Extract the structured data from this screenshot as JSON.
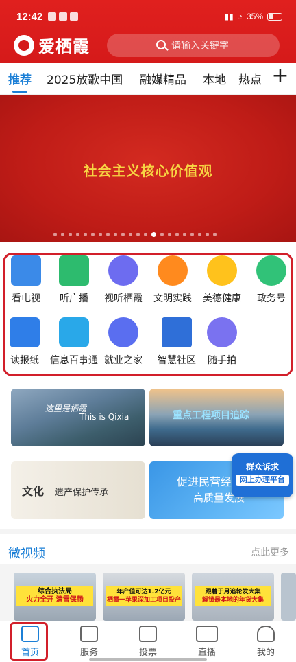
{
  "status_bar": {
    "time": "12:42",
    "battery": "35%"
  },
  "header": {
    "logo_text": "爱栖霞",
    "search_placeholder": "请输入关键字"
  },
  "tabs": [
    {
      "label": "推荐",
      "active": true
    },
    {
      "label": "2025放歌中国",
      "active": false
    },
    {
      "label": "融媒精品",
      "active": false
    },
    {
      "label": "本地",
      "active": false
    },
    {
      "label": "热点",
      "active": false
    }
  ],
  "banner": {
    "text": "社会主义核心价值观",
    "dot_count": 22,
    "active_dot": 13
  },
  "services": [
    {
      "label": "看电视",
      "icon": "tv-icon"
    },
    {
      "label": "听广播",
      "icon": "radio-icon"
    },
    {
      "label": "视听栖霞",
      "icon": "video-icon"
    },
    {
      "label": "文明实践",
      "icon": "fan-icon"
    },
    {
      "label": "美德健康",
      "icon": "document-icon"
    },
    {
      "label": "政务号",
      "icon": "person-icon"
    },
    {
      "label": "读报纸",
      "icon": "newspaper-icon"
    },
    {
      "label": "信息百事通",
      "icon": "grid-icon"
    },
    {
      "label": "就业之家",
      "icon": "building-icon"
    },
    {
      "label": "智慧社区",
      "icon": "institution-icon"
    },
    {
      "label": "随手拍",
      "icon": "camera-icon"
    }
  ],
  "promos": {
    "tile1_a": "这里是栖霞",
    "tile1_b": "This is Qixia",
    "tile2_a": "重点工程项目追踪",
    "tile3_a": "文化",
    "tile3_b": "遗产保护传承",
    "tile4_a": "促进民营经济",
    "tile4_b": "高质量发展",
    "float_line1": "群众诉求",
    "float_line2": "网上办理平台"
  },
  "micro_video": {
    "title": "微视频",
    "more": "点此更多",
    "videos": [
      {
        "line1": "综合执法局",
        "line2": "火力全开 清雪保畅"
      },
      {
        "line1": "年产值可达1.2亿元",
        "line2": "栖霞一苹果深加工项目投产"
      },
      {
        "line1": "跟着于月追轮发大集",
        "line2": "解锁最本地的年货大集"
      }
    ]
  },
  "bottom_nav": [
    {
      "label": "首页",
      "active": true
    },
    {
      "label": "服务",
      "active": false
    },
    {
      "label": "投票",
      "active": false
    },
    {
      "label": "直播",
      "active": false
    },
    {
      "label": "我的",
      "active": false
    }
  ],
  "colors": {
    "brand_red": "#d51a1a",
    "accent_blue": "#1b7fd6",
    "annotation_red": "#d21f2a"
  }
}
